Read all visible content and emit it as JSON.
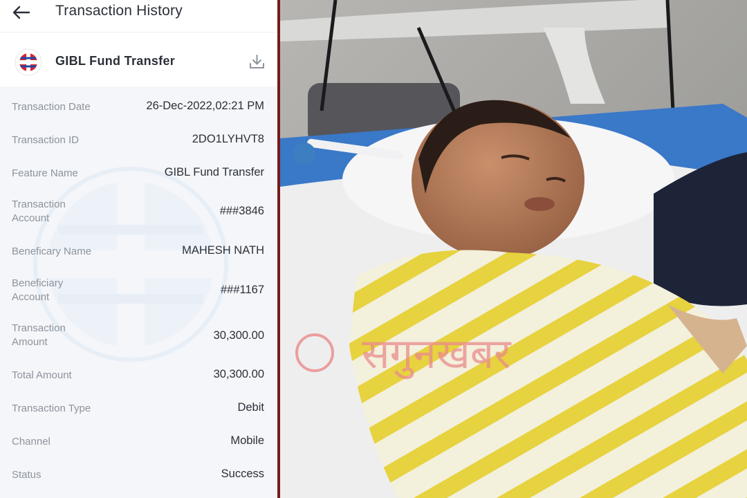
{
  "header": {
    "title": "Transaction History",
    "back_icon": "arrow-left-icon"
  },
  "feature": {
    "title": "GIBL Fund Transfer",
    "logo_icon": "bank-logo-icon",
    "download_icon": "download-icon"
  },
  "details": [
    {
      "label": "Transaction Date",
      "value": "26-Dec-2022,02:21 PM"
    },
    {
      "label": "Transaction ID",
      "value": "2DO1LYHVT8"
    },
    {
      "label": "Feature Name",
      "value": "GIBL Fund Transfer"
    },
    {
      "label": "Transaction Account",
      "value": "###3846"
    },
    {
      "label": "Beneficary Name",
      "value": "MAHESH NATH"
    },
    {
      "label": "Beneficiary Account",
      "value": "###1167"
    },
    {
      "label": "Transaction Amount",
      "value": "30,300.00"
    },
    {
      "label": "Total Amount",
      "value": "30,300.00"
    },
    {
      "label": "Transaction Type",
      "value": "Debit"
    },
    {
      "label": "Channel",
      "value": "Mobile"
    },
    {
      "label": "Status",
      "value": "Success"
    }
  ],
  "photo": {
    "subject": "sleeping-child-in-hospital-bed",
    "watermark_text": "सगुनखबर"
  },
  "colors": {
    "accent_red": "#d8232a",
    "logo_blue": "#1f4aa8",
    "divider": "#7a1a1a",
    "detail_background": "#f4f6f9"
  }
}
